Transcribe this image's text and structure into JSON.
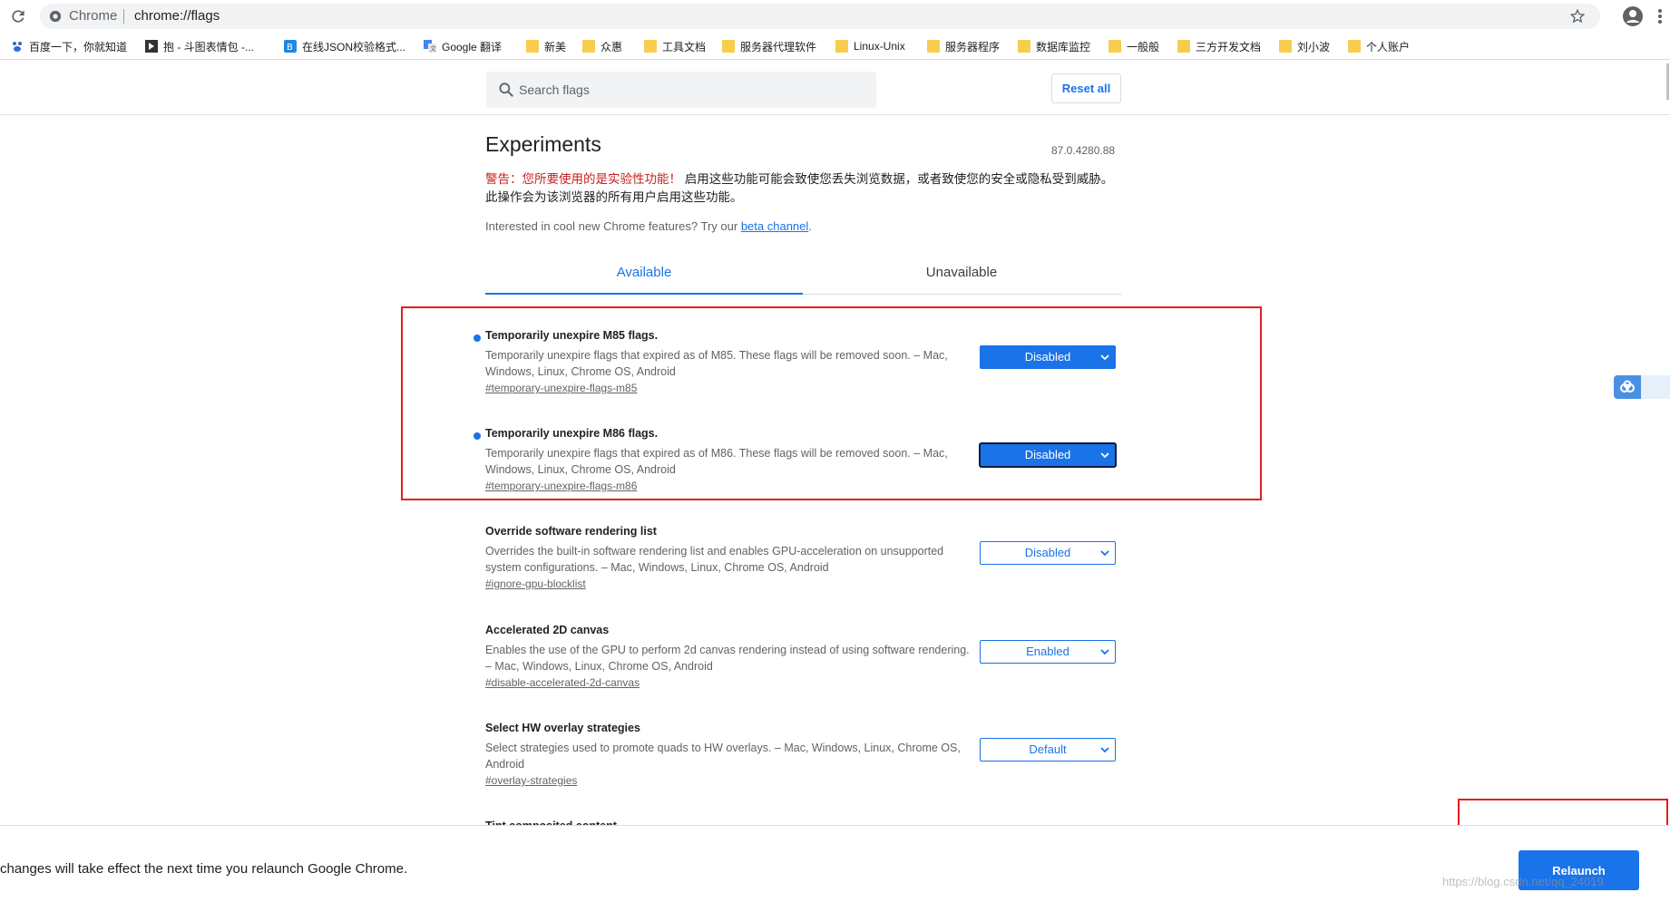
{
  "browser": {
    "site_label": "Chrome",
    "url": "chrome://flags",
    "bookmarks": [
      {
        "label": "百度一下，你就知道",
        "icon": "paw-icon"
      },
      {
        "label": "抱 - 斗图表情包 -...",
        "icon": "page-icon"
      },
      {
        "label": "在线JSON校验格式...",
        "icon": "json-icon"
      },
      {
        "label": "Google 翻译",
        "icon": "translate-icon"
      },
      {
        "label": "新美",
        "icon": "folder-icon"
      },
      {
        "label": "众惠",
        "icon": "folder-icon"
      },
      {
        "label": "工具文档",
        "icon": "folder-icon"
      },
      {
        "label": "服务器代理软件",
        "icon": "folder-icon"
      },
      {
        "label": "Linux-Unix",
        "icon": "folder-icon"
      },
      {
        "label": "服务器程序",
        "icon": "folder-icon"
      },
      {
        "label": "数据库监控",
        "icon": "folder-icon"
      },
      {
        "label": "一般般",
        "icon": "folder-icon"
      },
      {
        "label": "三方开发文档",
        "icon": "folder-icon"
      },
      {
        "label": "刘小波",
        "icon": "folder-icon"
      },
      {
        "label": "个人账户",
        "icon": "folder-icon"
      }
    ]
  },
  "flags_page": {
    "search_placeholder": "Search flags",
    "reset_label": "Reset all",
    "title": "Experiments",
    "version": "87.0.4280.88",
    "warning_red": "警告：您所要使用的是实验性功能！",
    "warning_text": "启用这些功能可能会致使您丢失浏览数据，或者致使您的安全或隐私受到威胁。此操作会为该浏览器的所有用户启用这些功能。",
    "interest_text": "Interested in cool new Chrome features? Try our",
    "beta_link": "beta channel",
    "interest_end": ".",
    "tabs": {
      "available": "Available",
      "unavailable": "Unavailable"
    },
    "flags": [
      {
        "name": "Temporarily unexpire M85 flags.",
        "desc": "Temporarily unexpire flags that expired as of M85. These flags will be removed soon. – Mac, Windows, Linux, Chrome OS, Android",
        "id": "#temporary-unexpire-flags-m85",
        "value": "Disabled",
        "modified": true
      },
      {
        "name": "Temporarily unexpire M86 flags.",
        "desc": "Temporarily unexpire flags that expired as of M86. These flags will be removed soon. – Mac, Windows, Linux, Chrome OS, Android",
        "id": "#temporary-unexpire-flags-m86",
        "value": "Disabled",
        "modified": true
      },
      {
        "name": "Override software rendering list",
        "desc": "Overrides the built-in software rendering list and enables GPU-acceleration on unsupported system configurations. – Mac, Windows, Linux, Chrome OS, Android",
        "id": "#ignore-gpu-blocklist",
        "value": "Disabled",
        "modified": false
      },
      {
        "name": "Accelerated 2D canvas",
        "desc": "Enables the use of the GPU to perform 2d canvas rendering instead of using software rendering. – Mac, Windows, Linux, Chrome OS, Android",
        "id": "#disable-accelerated-2d-canvas",
        "value": "Enabled",
        "modified": false
      },
      {
        "name": "Select HW overlay strategies",
        "desc": "Select strategies used to promote quads to HW overlays. – Mac, Windows, Linux, Chrome OS, Android",
        "id": "#overlay-strategies",
        "value": "Default",
        "modified": false
      },
      {
        "name": "Tint composited content",
        "desc": "",
        "id": "",
        "value": "",
        "modified": false
      }
    ],
    "relaunch_message": "changes will take effect the next time you relaunch Google Chrome.",
    "relaunch_label": "Relaunch",
    "watermark": "https://blog.csdn.net/qq_24019"
  },
  "colors": {
    "accent": "#1a73e8",
    "annotation": "#e02020",
    "warning": "#c5221f"
  }
}
